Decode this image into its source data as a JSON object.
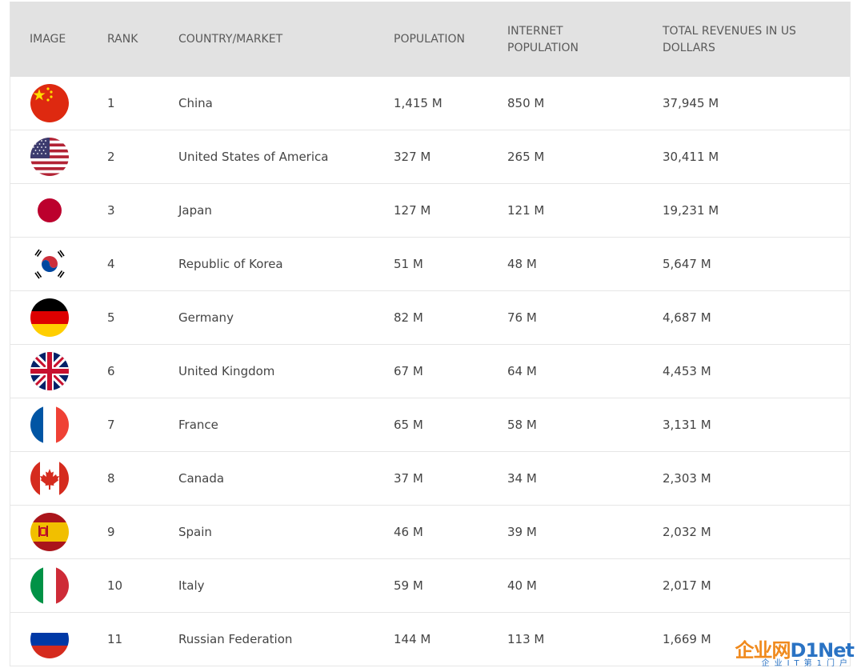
{
  "table": {
    "headers": {
      "image": "IMAGE",
      "rank": "RANK",
      "country": "COUNTRY/MARKET",
      "population": "POPULATION",
      "internet_line1": "INTERNET",
      "internet_line2": "POPULATION",
      "revenue_line1": "TOTAL REVENUES IN US",
      "revenue_line2": "DOLLARS"
    },
    "rows": [
      {
        "flag": "china-flag-icon",
        "rank": "1",
        "country": "China",
        "population": "1,415 M",
        "internet": "850 M",
        "revenue": "37,945 M"
      },
      {
        "flag": "usa-flag-icon",
        "rank": "2",
        "country": "United States of America",
        "population": "327 M",
        "internet": "265 M",
        "revenue": "30,411 M"
      },
      {
        "flag": "japan-flag-icon",
        "rank": "3",
        "country": "Japan",
        "population": "127 M",
        "internet": "121 M",
        "revenue": "19,231 M"
      },
      {
        "flag": "korea-flag-icon",
        "rank": "4",
        "country": "Republic of Korea",
        "population": "51 M",
        "internet": "48 M",
        "revenue": "5,647 M"
      },
      {
        "flag": "germany-flag-icon",
        "rank": "5",
        "country": "Germany",
        "population": "82 M",
        "internet": "76 M",
        "revenue": "4,687 M"
      },
      {
        "flag": "uk-flag-icon",
        "rank": "6",
        "country": "United Kingdom",
        "population": "67 M",
        "internet": "64 M",
        "revenue": "4,453 M"
      },
      {
        "flag": "france-flag-icon",
        "rank": "7",
        "country": "France",
        "population": "65 M",
        "internet": "58 M",
        "revenue": "3,131 M"
      },
      {
        "flag": "canada-flag-icon",
        "rank": "8",
        "country": "Canada",
        "population": "37 M",
        "internet": "34 M",
        "revenue": "2,303 M"
      },
      {
        "flag": "spain-flag-icon",
        "rank": "9",
        "country": "Spain",
        "population": "46 M",
        "internet": "39 M",
        "revenue": "2,032 M"
      },
      {
        "flag": "italy-flag-icon",
        "rank": "10",
        "country": "Italy",
        "population": "59 M",
        "internet": "40 M",
        "revenue": "2,017 M"
      },
      {
        "flag": "russia-flag-icon",
        "rank": "11",
        "country": "Russian Federation",
        "population": "144 M",
        "internet": "113 M",
        "revenue": "1,669 M"
      }
    ]
  },
  "watermark": {
    "part1": "企业网",
    "part2": "D1Net",
    "sub": "企业IT第1门户"
  },
  "colors": {
    "header_bg": "#e2e2e2",
    "row_border": "#e6e6e6",
    "text": "#444444",
    "header_text": "#5a5a5a"
  }
}
